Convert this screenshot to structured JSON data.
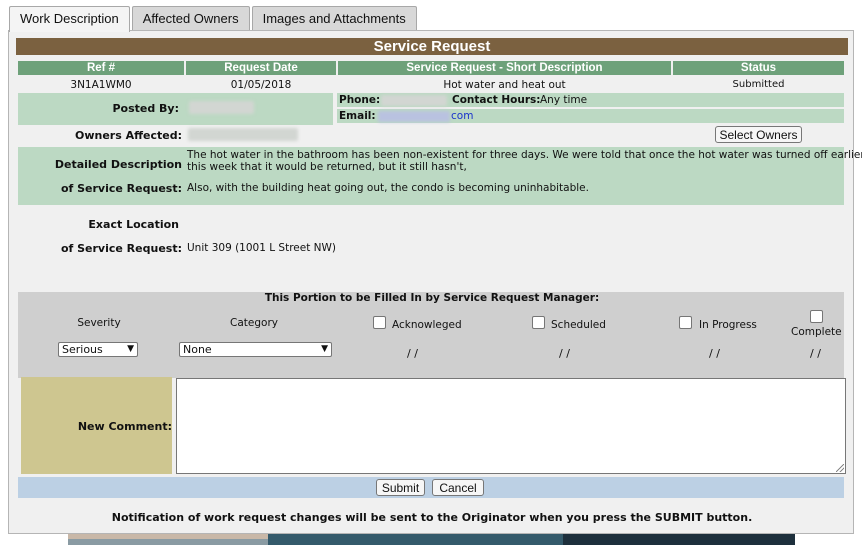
{
  "tabs": [
    "Work Description",
    "Affected Owners",
    "Images and Attachments"
  ],
  "title": "Service Request",
  "headers": {
    "ref": "Ref #",
    "date": "Request Date",
    "desc": "Service Request - Short Description",
    "status": "Status"
  },
  "request": {
    "ref": "3N1A1WM0",
    "date": "01/05/2018",
    "short_desc": "Hot water and heat out",
    "status": "Submitted"
  },
  "posted_by": {
    "label": "Posted By:",
    "phone_label": "Phone:",
    "contact_label": "Contact Hours:",
    "contact_value": "Any time",
    "email_label": "Email:",
    "email_suffix": "com"
  },
  "owners": {
    "label": "Owners Affected:",
    "button": "Select Owners"
  },
  "detail": {
    "label_1": "Detailed Description",
    "label_2": "of Service Request:",
    "line_1": "The hot water in the bathroom has been non-existent for three days. We were told that once the hot water was turned off earlier",
    "line_2": "this week that it would be returned, but it still hasn't,",
    "line_3": "Also, with the building heat going out, the condo is becoming uninhabitable."
  },
  "location": {
    "label_1": "Exact Location",
    "label_2": "of Service Request:",
    "value": "Unit 309 (1001 L Street NW)"
  },
  "manager": {
    "heading": "This Portion to be Filled In by Service Request Manager:",
    "severity_label": "Severity",
    "category_label": "Category",
    "acknowledged": "Acknowleged",
    "scheduled": "Scheduled",
    "in_progress": "In Progress",
    "complete": "Complete",
    "severity_value": "Serious",
    "category_value": "None",
    "date_placeholder": "/ /"
  },
  "comment": {
    "label": "New Comment:",
    "value": ""
  },
  "buttons": {
    "submit": "Submit",
    "cancel": "Cancel"
  },
  "note": "Notification of work request changes will be sent to the Originator when you press the SUBMIT button.",
  "colors": {
    "title_bar": "#7b6140",
    "header_green": "#6ea17a",
    "light_green": "#bcd9c3",
    "comment_tan": "#cec690",
    "submit_blue": "#bcd0e4",
    "link_blue": "#1a33cc"
  }
}
